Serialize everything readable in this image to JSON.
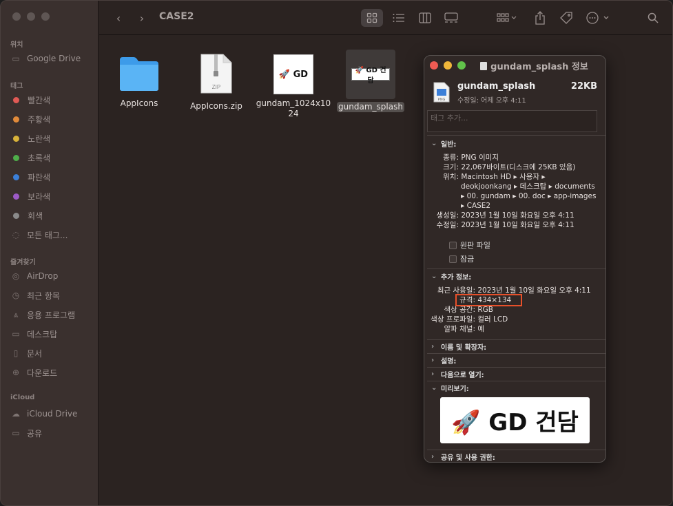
{
  "window": {
    "title": "CASE2"
  },
  "sidebar": {
    "sections": [
      {
        "title": "위치",
        "items": [
          {
            "label": "Google Drive",
            "icon": "drive-icon"
          }
        ]
      },
      {
        "title": "태그",
        "items": [
          {
            "label": "빨간색",
            "color": "#e05a55"
          },
          {
            "label": "주황색",
            "color": "#e08a3a"
          },
          {
            "label": "노란색",
            "color": "#d8b23a"
          },
          {
            "label": "초록색",
            "color": "#4fae4a"
          },
          {
            "label": "파란색",
            "color": "#3b7fd8"
          },
          {
            "label": "보라색",
            "color": "#9c5ac6"
          },
          {
            "label": "회색",
            "color": "#8a8a8a"
          },
          {
            "label": "모든 태그...",
            "icon": "all-tags-icon"
          }
        ]
      },
      {
        "title": "즐겨찾기",
        "items": [
          {
            "label": "AirDrop",
            "icon": "airdrop-icon"
          },
          {
            "label": "최근 항목",
            "icon": "clock-icon"
          },
          {
            "label": "응용 프로그램",
            "icon": "applications-icon"
          },
          {
            "label": "데스크탑",
            "icon": "desktop-icon"
          },
          {
            "label": "문서",
            "icon": "document-icon"
          },
          {
            "label": "다운로드",
            "icon": "download-icon"
          }
        ]
      },
      {
        "title": "iCloud",
        "items": [
          {
            "label": "iCloud Drive",
            "icon": "cloud-icon"
          },
          {
            "label": "공유",
            "icon": "shared-folder-icon"
          }
        ]
      }
    ]
  },
  "files": [
    {
      "name": "AppIcons",
      "kind": "folder"
    },
    {
      "name": "AppIcons.zip",
      "kind": "zip",
      "badge": "ZIP"
    },
    {
      "name": "gundam_1024x1024",
      "line1": "gundam_1024x10",
      "line2": "24",
      "kind": "image",
      "thumb": "🚀 GD"
    },
    {
      "name": "gundam_splash",
      "kind": "image",
      "thumb": "🚀 GD 건담",
      "selected": true
    }
  ],
  "info": {
    "title": "gundam_splash 정보",
    "file_name": "gundam_splash",
    "size_short": "22KB",
    "modified_short": "수정일: 어제 오후 4:11",
    "tags_placeholder": "태그 추가...",
    "general": {
      "heading": "일반:",
      "kind_k": "종류:",
      "kind_v": "PNG 이미지",
      "size_k": "크기:",
      "size_v": "22,067바이트(디스크에 25KB 있음)",
      "where_k": "위치:",
      "where_l1": "Macintosh HD ▸ 사용자 ▸",
      "where_l2": "deokjoonkang ▸ 데스크탑 ▸ documents",
      "where_l3": "▸ 00. gundam ▸ 00. doc ▸ app-images",
      "where_l4": "▸ CASE2",
      "created_k": "생성일:",
      "created_v": "2023년 1월 10일 화요일 오후 4:11",
      "modified_k": "수정일:",
      "modified_v": "2023년 1월 10일 화요일 오후 4:11",
      "stationery": "원판 파일",
      "locked": "잠금"
    },
    "more": {
      "heading": "추가 정보:",
      "last_opened_k": "최근 사용일:",
      "last_opened_v": "2023년 1월 10일 화요일 오후 4:11",
      "dimensions_k": "규격:",
      "dimensions_v": "434×134",
      "color_space_k": "색상 공간:",
      "color_space_v": "RGB",
      "color_profile_k": "색상 프로파일:",
      "color_profile_v": "컬러 LCD",
      "alpha_k": "알파 채널:",
      "alpha_v": "예"
    },
    "name_ext": "이름 및 확장자:",
    "comments": "설명:",
    "open_with": "다음으로 열기:",
    "preview_heading": "미리보기:",
    "preview_text": "🚀 GD 건담",
    "sharing": "공유 및 사용 권한:"
  }
}
